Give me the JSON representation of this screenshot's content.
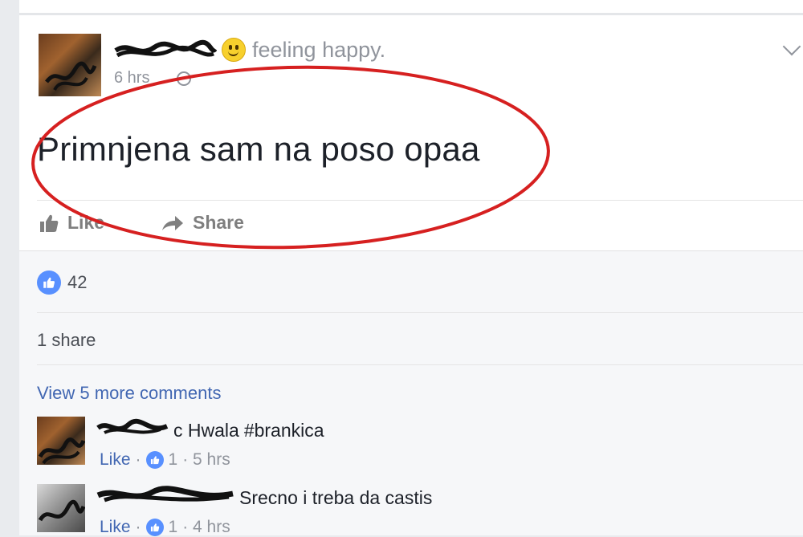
{
  "post": {
    "feeling": "feeling happy.",
    "time": "6 hrs",
    "text": "Primnjena sam na poso opaa"
  },
  "actions": {
    "like": "Like",
    "share": "Share"
  },
  "stats": {
    "likes_count": "42",
    "shares": "1 share"
  },
  "comments_section": {
    "view_more": "View 5 more comments"
  },
  "comments": [
    {
      "name_visible": "c Hwala",
      "text": "#brankica",
      "like": "Like",
      "sep": "·",
      "likes": "1",
      "time": "· 5 hrs"
    },
    {
      "name_visible": "",
      "text": "Srecno i treba da castis",
      "like": "Like",
      "sep": "·",
      "likes": "1",
      "time": "· 4 hrs"
    }
  ],
  "colors": {
    "accent": "#4267b2",
    "like_blue": "#5890ff",
    "annotation_red": "#d62020"
  }
}
